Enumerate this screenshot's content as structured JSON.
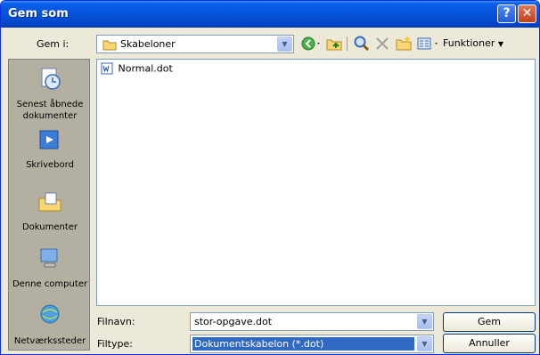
{
  "window": {
    "title": "Gem som"
  },
  "toolbar": {
    "save_in_label": "Gem i:",
    "save_in_value": "Skabeloner",
    "tools_label": "Funktioner"
  },
  "places": [
    {
      "label": "Senest åbnede dokumenter",
      "icon": "recent-documents-icon"
    },
    {
      "label": "Skrivebord",
      "icon": "desktop-icon"
    },
    {
      "label": "Dokumenter",
      "icon": "documents-folder-icon"
    },
    {
      "label": "Denne computer",
      "icon": "my-computer-icon"
    },
    {
      "label": "Netværkssteder",
      "icon": "network-places-icon"
    }
  ],
  "files": [
    {
      "name": "Normal.dot",
      "icon": "word-template-icon"
    }
  ],
  "filename": {
    "label": "Filnavn:",
    "value": "stor-opgave.dot"
  },
  "filetype": {
    "label": "Filtype:",
    "value": "Dokumentskabelon (*.dot)"
  },
  "buttons": {
    "save": "Gem",
    "cancel": "Annuller"
  }
}
